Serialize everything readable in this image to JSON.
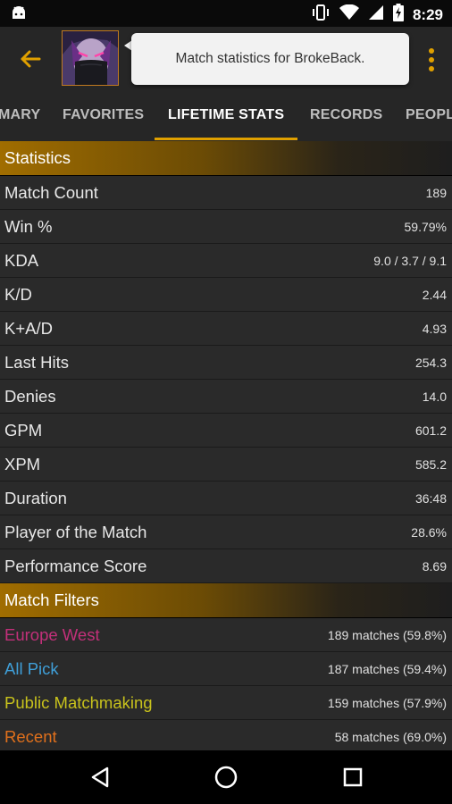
{
  "status": {
    "time": "8:29"
  },
  "toast": {
    "message": "Match statistics for BrokeBack."
  },
  "tabs": [
    "MARY",
    "FAVORITES",
    "LIFETIME STATS",
    "RECORDS",
    "PEOPL"
  ],
  "statistics": {
    "title": "Statistics",
    "rows": [
      {
        "label": "Match Count",
        "value": "189"
      },
      {
        "label": "Win %",
        "value": "59.79%"
      },
      {
        "label": "KDA",
        "value": "9.0 / 3.7 / 9.1"
      },
      {
        "label": "K/D",
        "value": "2.44"
      },
      {
        "label": "K+A/D",
        "value": "4.93"
      },
      {
        "label": "Last Hits",
        "value": "254.3"
      },
      {
        "label": "Denies",
        "value": "14.0"
      },
      {
        "label": "GPM",
        "value": "601.2"
      },
      {
        "label": "XPM",
        "value": "585.2"
      },
      {
        "label": "Duration",
        "value": "36:48"
      },
      {
        "label": "Player of the Match",
        "value": "28.6%"
      },
      {
        "label": "Performance Score",
        "value": "8.69"
      }
    ]
  },
  "filters": {
    "title": "Match Filters",
    "rows": [
      {
        "label": "Europe West",
        "value": "189 matches (59.8%)",
        "color": "#c2307a"
      },
      {
        "label": "All Pick",
        "value": "187 matches (59.4%)",
        "color": "#3f9fd8"
      },
      {
        "label": "Public Matchmaking",
        "value": "159 matches (57.9%)",
        "color": "#c8c21c"
      },
      {
        "label": "Recent",
        "value": "58 matches (69.0%)",
        "color": "#e0701c"
      }
    ]
  },
  "colors": {
    "accent": "#e0a000",
    "toast_bg": "#f2f2f2"
  }
}
